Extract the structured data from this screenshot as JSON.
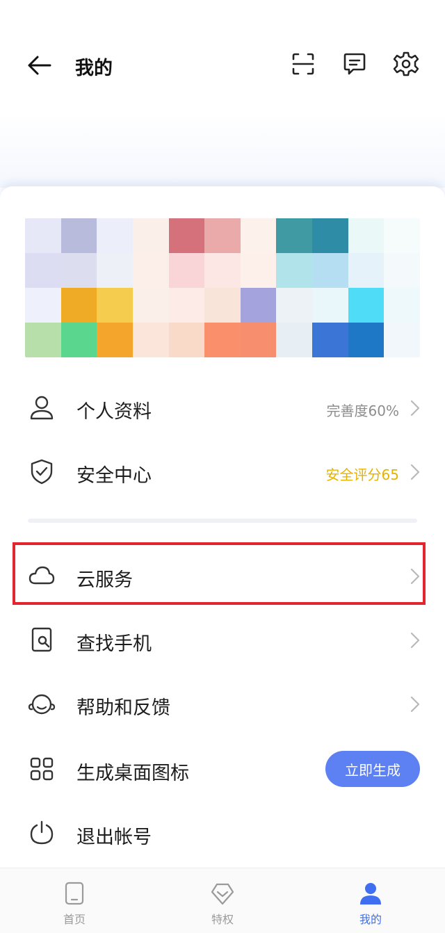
{
  "header": {
    "title": "我的"
  },
  "menu": {
    "profile": {
      "label": "个人资料",
      "right": "完善度60%"
    },
    "security": {
      "label": "安全中心",
      "right": "安全评分65"
    },
    "cloud": {
      "label": "云服务"
    },
    "find_phone": {
      "label": "查找手机"
    },
    "help": {
      "label": "帮助和反馈"
    },
    "desktop_icon": {
      "label": "生成桌面图标",
      "button": "立即生成"
    },
    "logout": {
      "label": "退出帐号"
    }
  },
  "tabbar": {
    "items": [
      {
        "label": "首页"
      },
      {
        "label": "特权"
      },
      {
        "label": "我的"
      }
    ]
  },
  "colors": {
    "accent": "#3f6ff0",
    "button": "#5d80f2",
    "warning_text": "#e4b300",
    "highlight_border": "#e3262e"
  }
}
